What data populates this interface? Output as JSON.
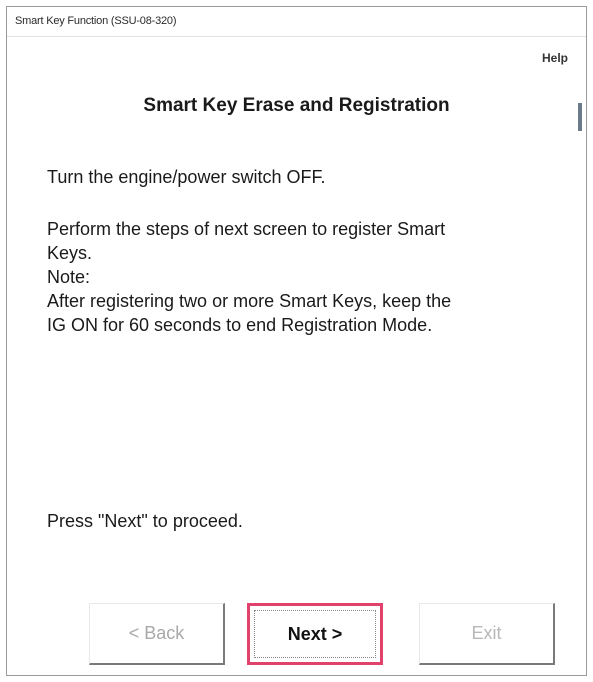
{
  "window": {
    "title": "Smart Key Function (SSU-08-320)"
  },
  "header": {
    "help_label": "Help"
  },
  "main": {
    "title": "Smart Key Erase and Registration",
    "line1": "Turn the engine/power switch OFF.",
    "line2": "Perform the steps of next screen to register Smart",
    "line3": "Keys.",
    "line4": "Note:",
    "line5": "After registering two or more Smart Keys, keep the",
    "line6": "IG ON for 60 seconds to end Registration Mode.",
    "proceed": "Press \"Next\" to proceed."
  },
  "buttons": {
    "back": "< Back",
    "next": "Next >",
    "exit": "Exit"
  }
}
